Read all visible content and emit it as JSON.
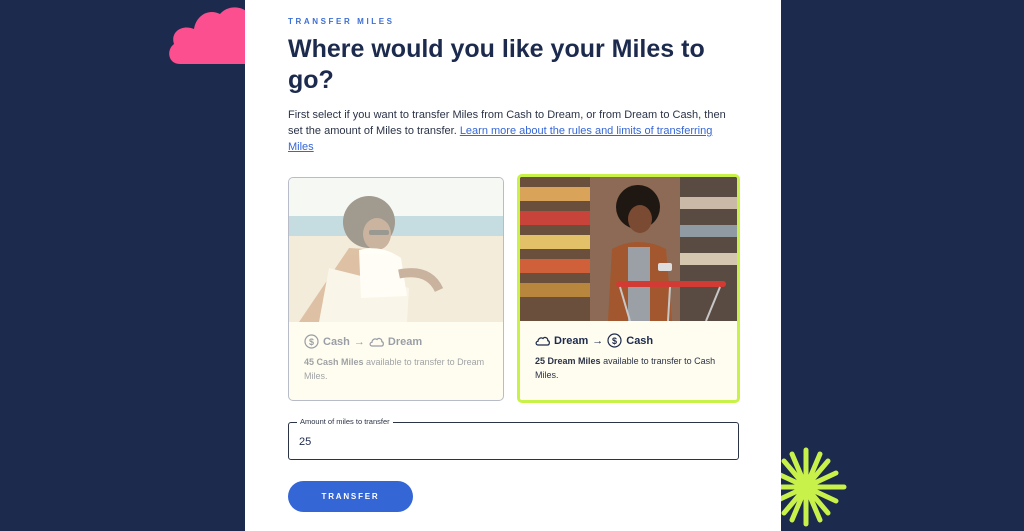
{
  "colors": {
    "page_bg": "#1c2a4d",
    "accent_blue": "#3566d6",
    "selected_border": "#c8f24a",
    "cloud_pink": "#fc4f8f",
    "burst_lime": "#c8f24a"
  },
  "header": {
    "eyebrow": "TRANSFER MILES",
    "title": "Where would you like your Miles to go?"
  },
  "intro": {
    "text": "First select if you want to transfer Miles from Cash to Dream, or from Dream to Cash, then set the amount of Miles to transfer.",
    "link_text": "Learn more about the rules and limits of transferring Miles"
  },
  "options": [
    {
      "from_label": "Cash",
      "from_icon": "dollar-coin-icon",
      "arrow": "→",
      "to_label": "Dream",
      "to_icon": "cloud-icon",
      "miles_bold": "45 Cash Miles",
      "miles_rest": "available to transfer to Dream Miles.",
      "selected": false
    },
    {
      "from_label": "Dream",
      "from_icon": "cloud-icon",
      "arrow": "→",
      "to_label": "Cash",
      "to_icon": "dollar-coin-icon",
      "miles_bold": "25 Dream Miles",
      "miles_rest": "available to transfer to Cash Miles.",
      "selected": true
    }
  ],
  "amount": {
    "label": "Amount of miles to transfer",
    "value": "25"
  },
  "actions": {
    "transfer_label": "TRANSFER"
  }
}
